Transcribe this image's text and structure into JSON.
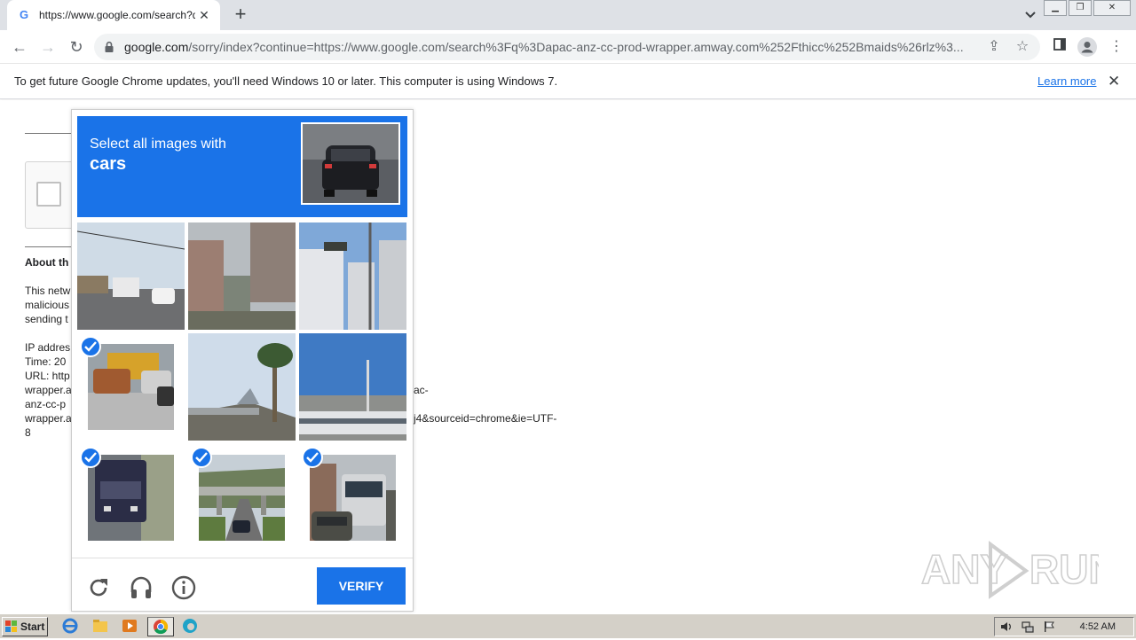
{
  "browser": {
    "tab_title": "https://www.google.com/search?q=",
    "tab_favicon": "G",
    "url_host": "google.com",
    "url_rest": "/sorry/index?continue=https://www.google.com/search%3Fq%3Dapac-anz-cc-prod-wrapper.amway.com%252Fthicc%252Bmaids%26rlz%3...",
    "infobar_message": "To get future Google Chrome updates, you'll need Windows 10 or later. This computer is using Windows 7.",
    "infobar_link": "Learn more"
  },
  "page": {
    "about_heading": "About th",
    "lines_left": [
      "This netw",
      "malicious",
      "sending t",
      "IP addres",
      "Time: 20",
      "URL: http",
      "wrapper.a",
      "anz-cc-p",
      "wrapper.a",
      "8"
    ],
    "lines_right": [
      "ac-",
      "j4&sourceid=chrome&ie=UTF-"
    ]
  },
  "captcha": {
    "instruction": "Select all images with",
    "target": "cars",
    "tiles": [
      {
        "name": "street-bus-cars",
        "selected": false
      },
      {
        "name": "buildings-alley",
        "selected": false
      },
      {
        "name": "traffic-light-buildings",
        "selected": false
      },
      {
        "name": "bus-suvs-intersection",
        "selected": true
      },
      {
        "name": "palm-bridge",
        "selected": false
      },
      {
        "name": "streetlight-rvs",
        "selected": false
      },
      {
        "name": "truck-road",
        "selected": true
      },
      {
        "name": "bridge-highway-car",
        "selected": true
      },
      {
        "name": "bus-car-street",
        "selected": true
      }
    ],
    "verify_label": "VERIFY",
    "accent_color": "#1a73e8"
  },
  "taskbar": {
    "start_label": "Start",
    "clock": "4:52 AM"
  },
  "watermark": "ANY RUN"
}
